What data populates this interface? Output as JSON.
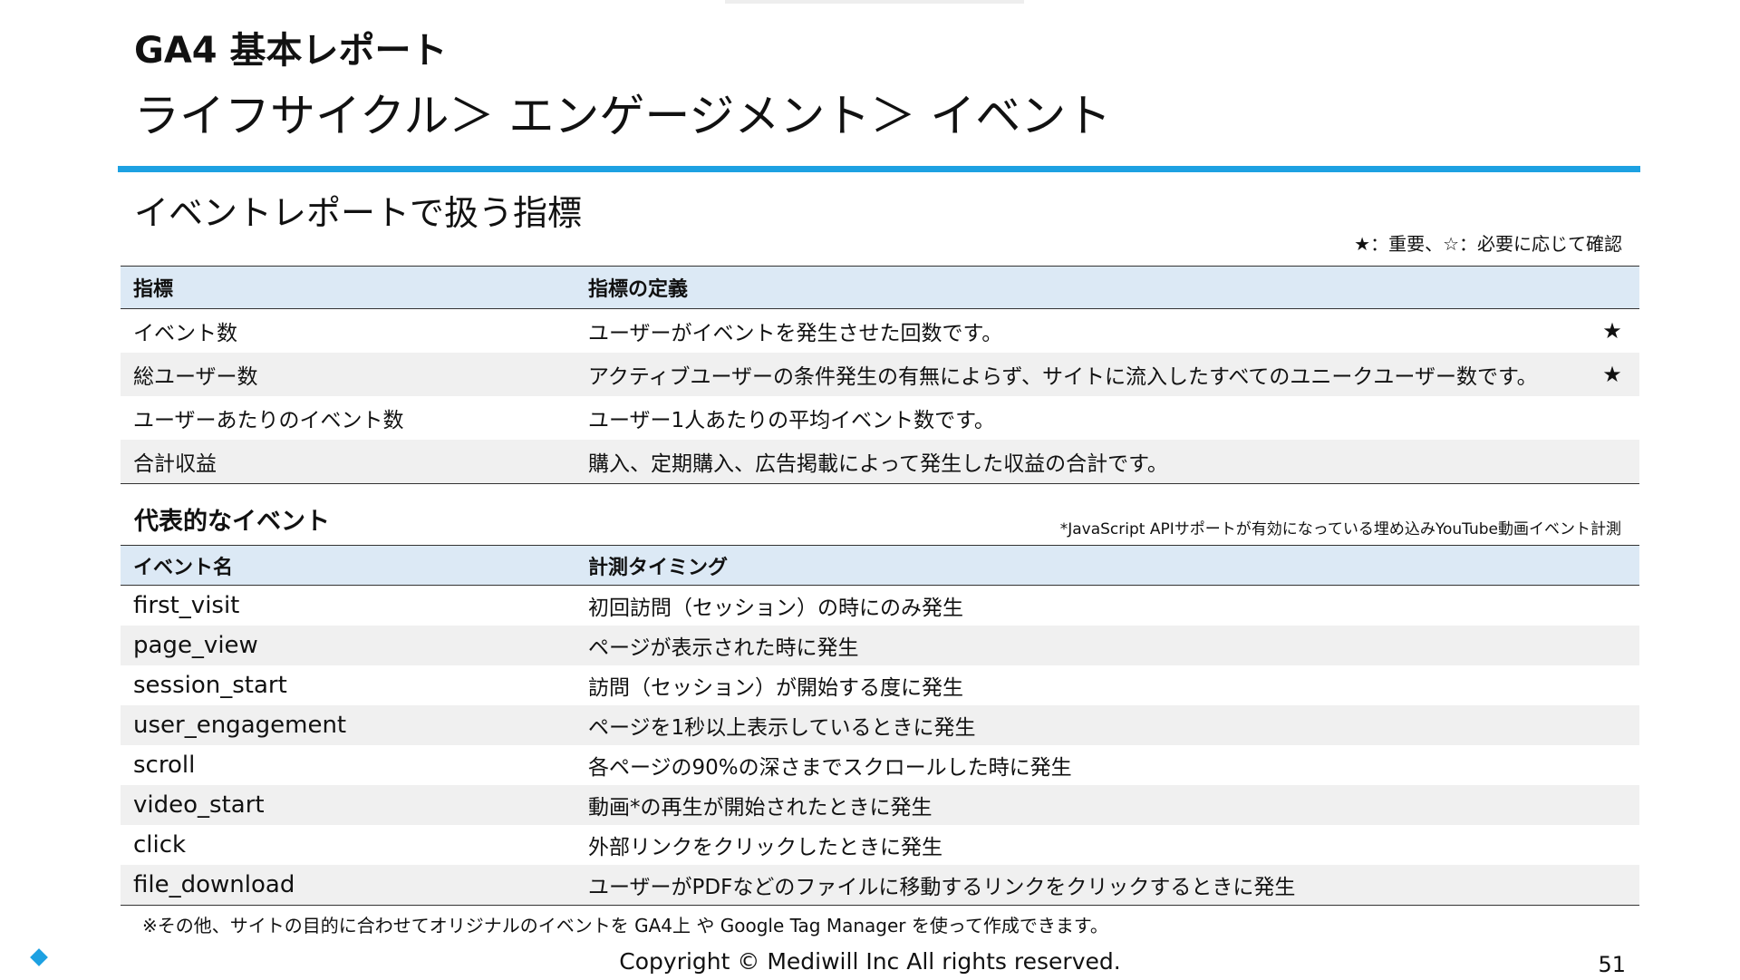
{
  "slide": {
    "kicker": "GA4 基本レポート",
    "title": "ライフサイクル＞ エンゲージメント＞ イベント",
    "accent_color": "#1da1e2",
    "header_fill": "#dce9f5",
    "alt_row_fill": "#f0f0f0"
  },
  "metrics_section": {
    "heading": "イベントレポートで扱う指標",
    "legend": "★：重要、☆：必要に応じて確認",
    "columns": [
      "指標",
      "指標の定義"
    ],
    "rows": [
      {
        "metric": "イベント数",
        "definition": "ユーザーがイベントを発生させた回数です。",
        "mark": "★"
      },
      {
        "metric": "総ユーザー数",
        "definition": "アクティブユーザーの条件発生の有無によらず、サイトに流入したすべてのユニークユーザー数です。",
        "mark": "★"
      },
      {
        "metric": "ユーザーあたりのイベント数",
        "definition": "ユーザー1人あたりの平均イベント数です。",
        "mark": ""
      },
      {
        "metric": "合計収益",
        "definition": "購入、定期購入、広告掲載によって発生した収益の合計です。",
        "mark": ""
      }
    ]
  },
  "events_section": {
    "heading": "代表的なイベント",
    "note": "*JavaScript APIサポートが有効になっている埋め込みYouTube動画イベント計測",
    "columns": [
      "イベント名",
      "計測タイミング"
    ],
    "rows": [
      {
        "name": "first_visit",
        "timing": "初回訪問（セッション）の時にのみ発生"
      },
      {
        "name": "page_view",
        "timing": "ページが表示された時に発生"
      },
      {
        "name": "session_start",
        "timing": "訪問（セッション）が開始する度に発生"
      },
      {
        "name": "user_engagement",
        "timing": "ページを1秒以上表示しているときに発生"
      },
      {
        "name": "scroll",
        "timing": "各ページの90%の深さまでスクロールした時に発生"
      },
      {
        "name": "video_start",
        "timing": "動画*の再生が開始されたときに発生"
      },
      {
        "name": "click",
        "timing": "外部リンクをクリックしたときに発生"
      },
      {
        "name": "file_download",
        "timing": "ユーザーがPDFなどのファイルに移動するリンクをクリックするときに発生"
      }
    ],
    "footnote": "※その他、サイトの目的に合わせてオリジナルのイベントを GA4上 や Google Tag Manager を使って作成できます。"
  },
  "footer": {
    "copyright": "Copyright © Mediwill Inc All rights reserved.",
    "page_number": "51",
    "bullet_icon": "diamond-icon"
  }
}
